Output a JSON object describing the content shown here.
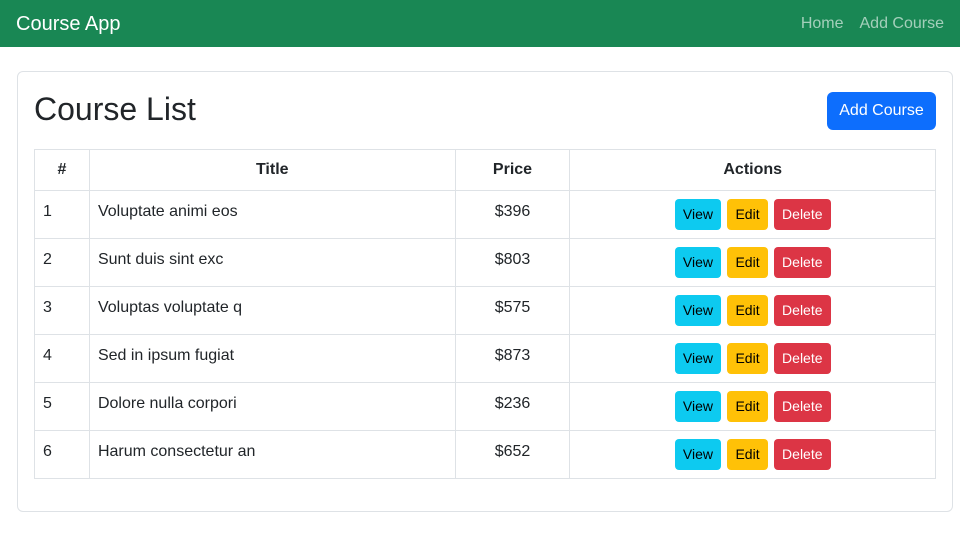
{
  "navbar": {
    "brand": "Course App",
    "links": [
      "Home",
      "Add Course"
    ]
  },
  "page": {
    "title": "Course List",
    "add_button": "Add Course"
  },
  "table": {
    "headers": [
      "#",
      "Title",
      "Price",
      "Actions"
    ],
    "action_labels": {
      "view": "View",
      "edit": "Edit",
      "delete": "Delete"
    },
    "rows": [
      {
        "num": "1",
        "title": "Voluptate animi eos",
        "price": "$396"
      },
      {
        "num": "2",
        "title": "Sunt duis sint exc",
        "price": "$803"
      },
      {
        "num": "3",
        "title": "Voluptas voluptate q",
        "price": "$575"
      },
      {
        "num": "4",
        "title": "Sed in ipsum fugiat",
        "price": "$873"
      },
      {
        "num": "5",
        "title": "Dolore nulla corpori",
        "price": "$236"
      },
      {
        "num": "6",
        "title": "Harum consectetur an",
        "price": "$652"
      }
    ]
  },
  "colors": {
    "navbar": "#198754",
    "primary": "#0d6efd",
    "info": "#0dcaf0",
    "warning": "#ffc107",
    "danger": "#dc3545"
  }
}
